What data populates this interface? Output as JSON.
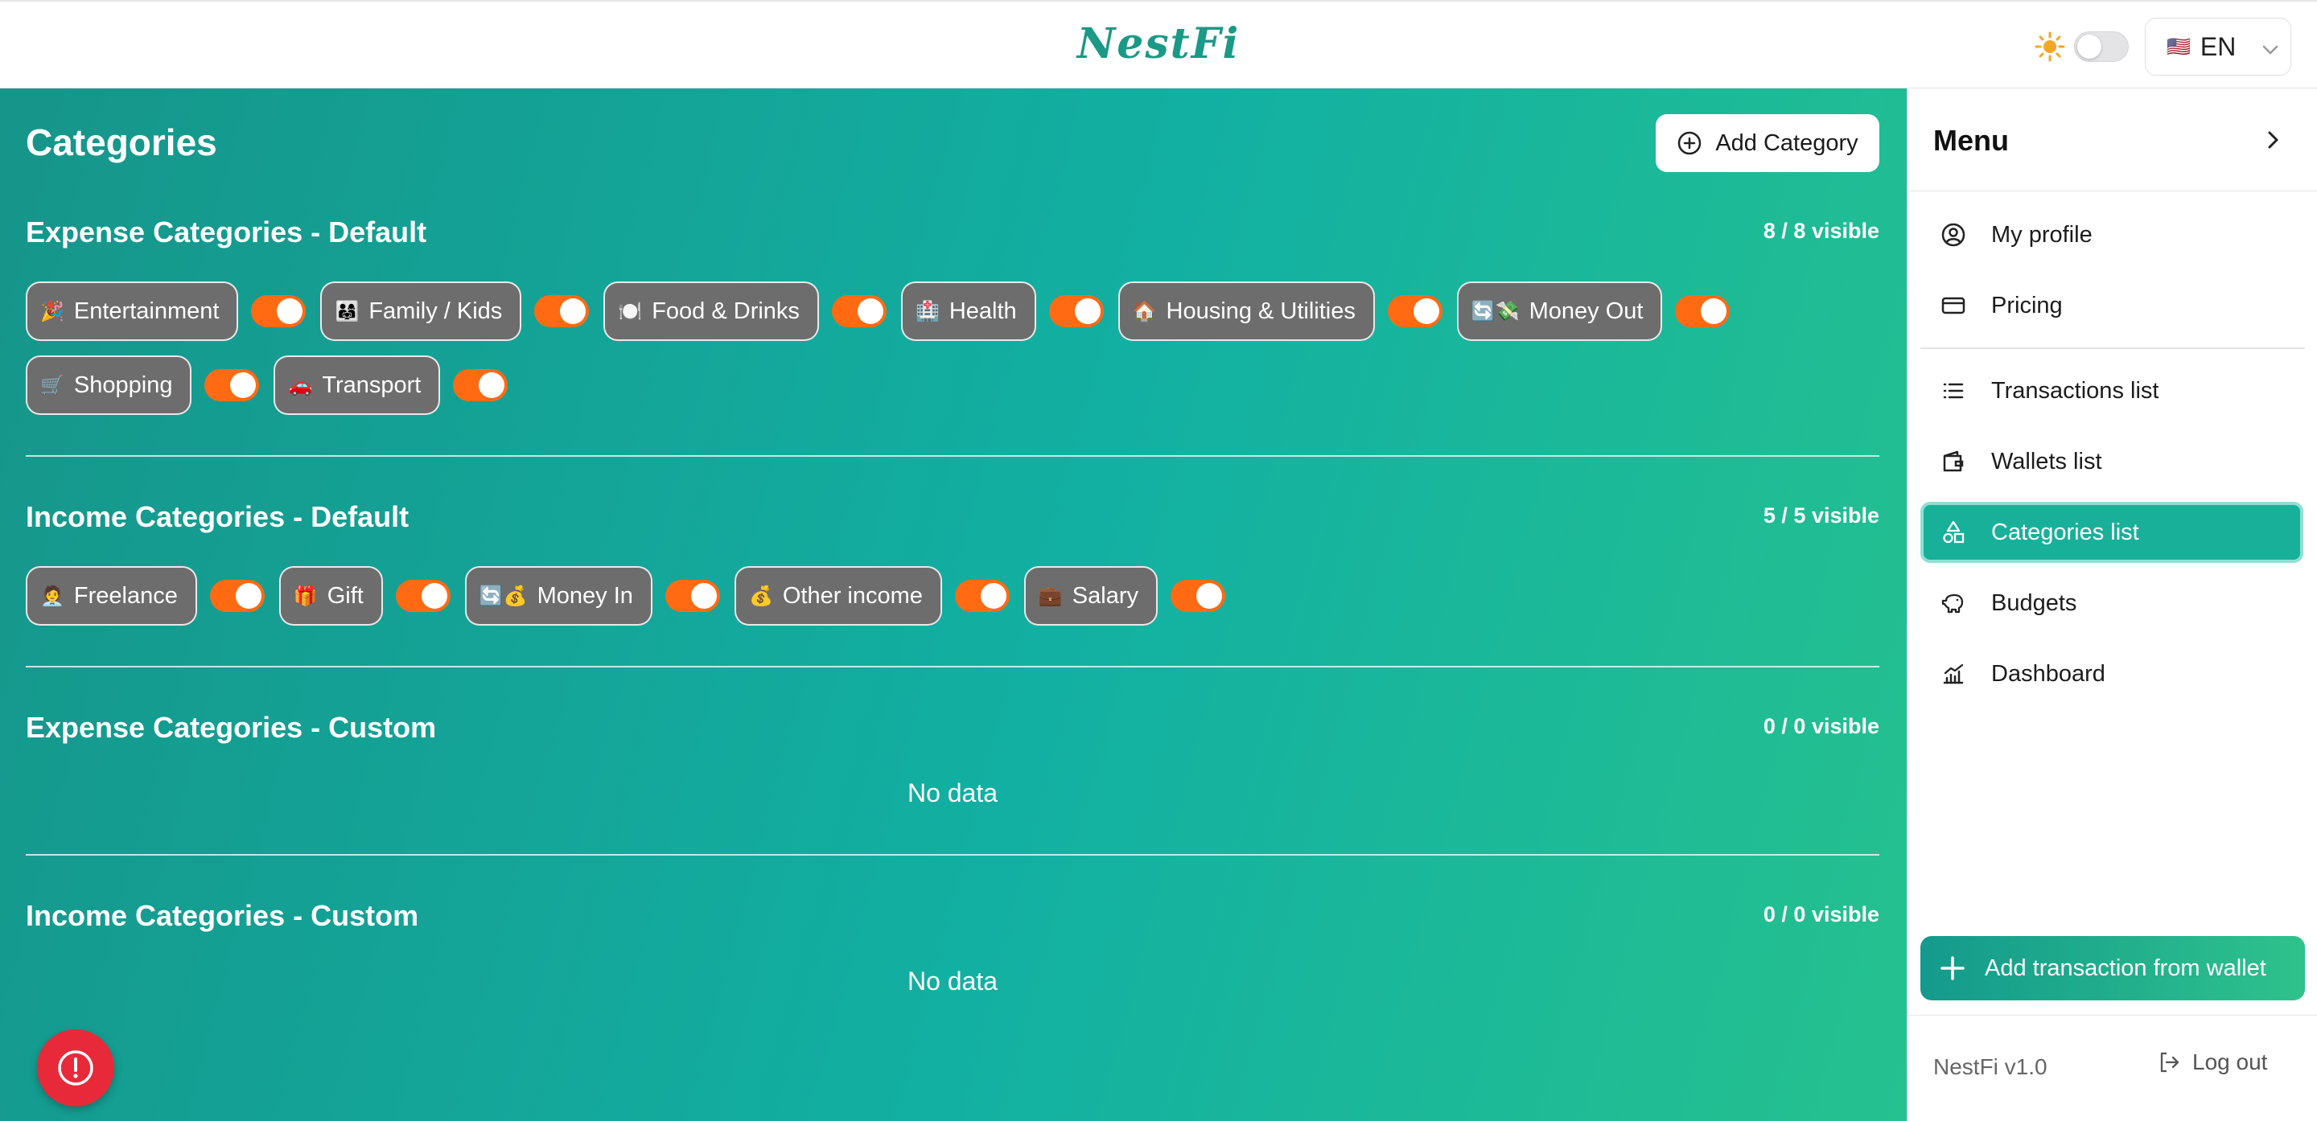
{
  "header": {
    "brand": "NestFi",
    "language": "EN",
    "flag": "🇺🇸"
  },
  "main": {
    "title": "Categories",
    "add_category_label": "Add Category",
    "sections": [
      {
        "title": "Expense Categories - Default",
        "count": "8 / 8 visible"
      },
      {
        "title": "Income Categories - Default",
        "count": "5 / 5 visible"
      },
      {
        "title": "Expense Categories - Custom",
        "count": "0 / 0 visible",
        "empty": "No data"
      },
      {
        "title": "Income Categories - Custom",
        "count": "0 / 0 visible",
        "empty": "No data"
      }
    ],
    "expense_default": [
      {
        "emoji": "🎉",
        "label": "Entertainment",
        "enabled": true
      },
      {
        "emoji": "👨‍👩‍👧",
        "label": "Family / Kids",
        "enabled": true
      },
      {
        "emoji": "🍽️",
        "label": "Food & Drinks",
        "enabled": true
      },
      {
        "emoji": "🏥",
        "label": "Health",
        "enabled": true
      },
      {
        "emoji": "🏠",
        "label": "Housing & Utilities",
        "enabled": true
      },
      {
        "emoji": "🔄💸",
        "label": "Money Out",
        "enabled": true
      },
      {
        "emoji": "🛒",
        "label": "Shopping",
        "enabled": true
      },
      {
        "emoji": "🚗",
        "label": "Transport",
        "enabled": true
      }
    ],
    "income_default": [
      {
        "emoji": "🧑‍💼",
        "label": "Freelance",
        "enabled": true
      },
      {
        "emoji": "🎁",
        "label": "Gift",
        "enabled": true
      },
      {
        "emoji": "🔄💰",
        "label": "Money In",
        "enabled": true
      },
      {
        "emoji": "💰",
        "label": "Other income",
        "enabled": true
      },
      {
        "emoji": "💼",
        "label": "Salary",
        "enabled": true
      }
    ]
  },
  "sidebar": {
    "title": "Menu",
    "items": [
      {
        "label": "My profile",
        "icon": "user-circle-icon"
      },
      {
        "label": "Pricing",
        "icon": "credit-card-icon"
      },
      {
        "label": "Transactions list",
        "icon": "list-icon"
      },
      {
        "label": "Wallets list",
        "icon": "wallet-icon"
      },
      {
        "label": "Categories list",
        "icon": "shapes-icon",
        "active": true
      },
      {
        "label": "Budgets",
        "icon": "piggy-bank-icon"
      },
      {
        "label": "Dashboard",
        "icon": "chart-icon"
      }
    ],
    "add_transaction_label": "Add transaction from wallet",
    "version": "NestFi v1.0",
    "logout_label": "Log out"
  },
  "colors": {
    "accent": "#19b09a",
    "toggle": "#ff6a13",
    "alert": "#e8293a",
    "chip": "#6d6d6d"
  }
}
